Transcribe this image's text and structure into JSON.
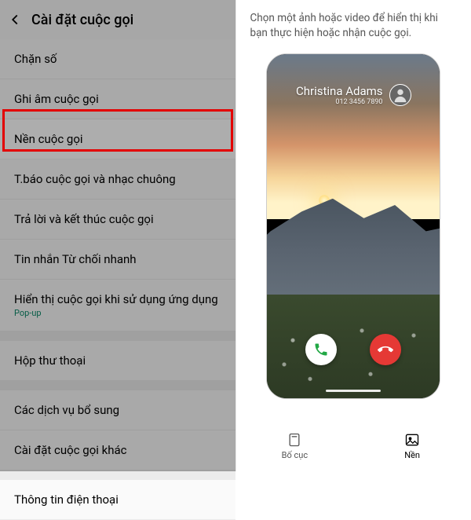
{
  "left": {
    "header_title": "Cài đặt cuộc gọi",
    "items": [
      {
        "label": "Chặn số"
      },
      {
        "label": "Ghi âm cuộc gọi"
      },
      {
        "label": "Nền cuộc gọi",
        "highlighted": true
      },
      {
        "label": "T.báo cuộc gọi và nhạc chuông"
      },
      {
        "label": "Trả lời và kết thúc cuộc gọi"
      },
      {
        "label": "Tin nhắn Từ chối nhanh"
      },
      {
        "label": "Hiển thị cuộc gọi khi sử dụng ứng dụng",
        "sub": "Pop-up"
      }
    ],
    "items2": [
      {
        "label": "Hộp thư thoại"
      }
    ],
    "items3": [
      {
        "label": "Các dịch vụ bổ sung"
      },
      {
        "label": "Cài đặt cuộc gọi khác"
      }
    ],
    "items4": [
      {
        "label": "Thông tin điện thoại"
      }
    ]
  },
  "right": {
    "description": "Chọn một ảnh hoặc video để hiển thị khi bạn thực hiện hoặc nhận cuộc gọi.",
    "caller_name": "Christina Adams",
    "caller_number": "012 3456 7890",
    "tabs": {
      "layout": "Bố cục",
      "background": "Nền"
    }
  }
}
